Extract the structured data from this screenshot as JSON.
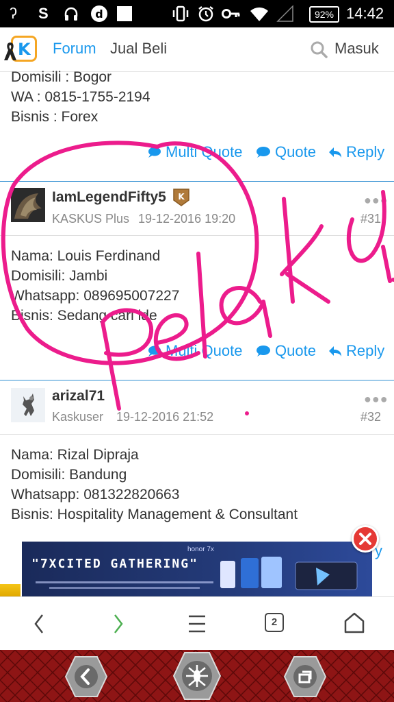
{
  "status_bar": {
    "battery": "92%",
    "time": "14:42"
  },
  "nav": {
    "logo_letter": "K",
    "forum": "Forum",
    "jual_beli": "Jual Beli",
    "masuk": "Masuk"
  },
  "post_prev": {
    "lines": [
      "Domisili : Bogor",
      "WA : 0815-1755-2194",
      "Bisnis : Forex"
    ]
  },
  "actions": {
    "multi_quote": "Multi Quote",
    "quote": "Quote",
    "reply": "Reply"
  },
  "post31": {
    "username": "IamLegendFifty5",
    "rank": "KASKUS Plus",
    "date": "19-12-2016 19:20",
    "number": "#31",
    "lines": [
      "Nama: Louis Ferdinand",
      "Domisili: Jambi",
      "Whatsapp: 089695007227",
      "Bisnis: Sedang cari ide"
    ]
  },
  "post32": {
    "username": "arizal71",
    "rank": "Kaskuser",
    "date": "19-12-2016 21:52",
    "number": "#32",
    "lines": [
      "Nama: Rizal Dipraja",
      "Domisili: Bandung",
      "Whatsapp: 081322820663",
      "Bisnis: Hospitality Management & Consultant"
    ]
  },
  "ad": {
    "title": "\"7XCITED GATHERING\"",
    "brand": "honor 7x"
  },
  "annotation": {
    "handwriting": "Pelaku",
    "color": "#ec1c8c"
  },
  "browser": {
    "tab_count": "2"
  }
}
